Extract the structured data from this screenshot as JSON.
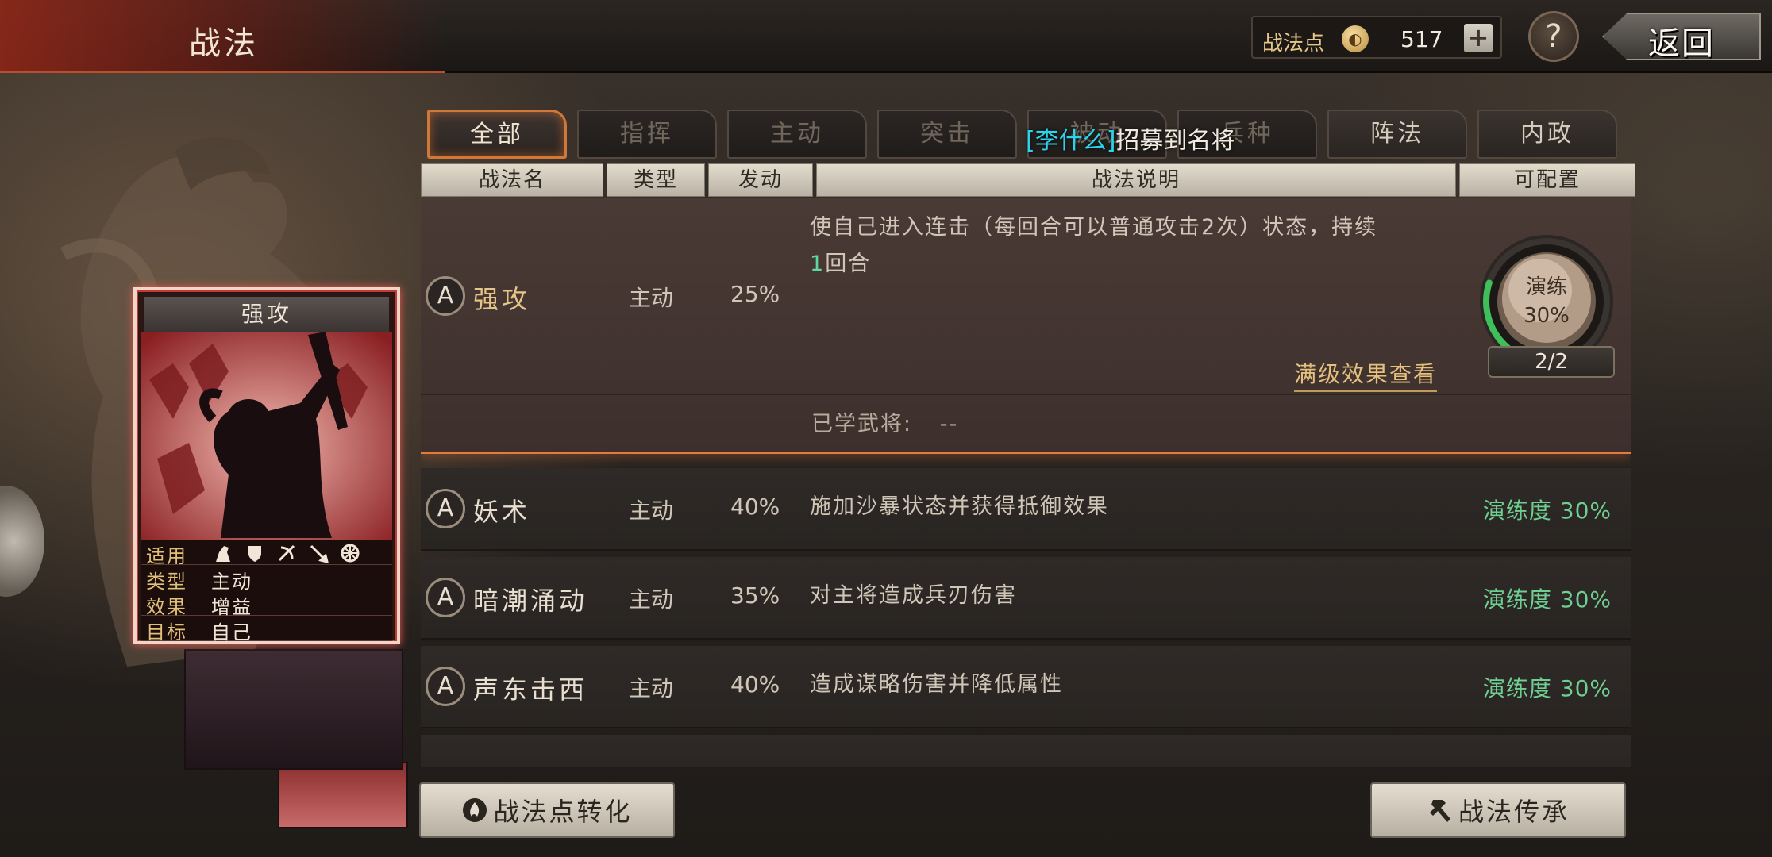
{
  "header": {
    "title": "战法",
    "points_label": "战法点",
    "points_value": "517",
    "plus_label": "+",
    "help_label": "?",
    "back_label": "返回"
  },
  "tabs": [
    {
      "label": "全部",
      "state": "active"
    },
    {
      "label": "指挥",
      "state": "dim"
    },
    {
      "label": "主动",
      "state": "dim"
    },
    {
      "label": "突击",
      "state": "dim"
    },
    {
      "label": "被动",
      "state": "dim"
    },
    {
      "label": "兵种",
      "state": "dim"
    },
    {
      "label": "阵法",
      "state": "normal"
    },
    {
      "label": "内政",
      "state": "normal"
    }
  ],
  "toast": {
    "name": "[李什么]",
    "text": "招募到名将"
  },
  "columns": [
    "战法名",
    "类型",
    "发动",
    "战法说明",
    "可配置"
  ],
  "selected": {
    "badge": "A",
    "name": "强攻",
    "type": "主动",
    "rate": "25%",
    "desc_line1": "使自己进入连击（每回合可以普通攻击2次）状态，持续",
    "desc_num": "1",
    "desc_line2_rest": "回合",
    "full_effect": "满级效果查看",
    "learned_label": "已学武将:",
    "learned_value": "--",
    "train_label": "演练",
    "train_pct": "30%",
    "train_count": "2/2",
    "train_progress": 0.3
  },
  "rows": [
    {
      "badge": "A",
      "name": "妖术",
      "type": "主动",
      "rate": "40%",
      "desc": "施加沙暴状态并获得抵御效果",
      "mastery": "演练度 30%"
    },
    {
      "badge": "A",
      "name": "暗潮涌动",
      "type": "主动",
      "rate": "35%",
      "desc": "对主将造成兵刃伤害",
      "mastery": "演练度 30%"
    },
    {
      "badge": "A",
      "name": "声东击西",
      "type": "主动",
      "rate": "40%",
      "desc": "造成谋略伤害并降低属性",
      "mastery": "演练度 30%"
    }
  ],
  "card": {
    "title": "强攻",
    "rows": [
      {
        "key": "适用",
        "value": ""
      },
      {
        "key": "类型",
        "value": "主动"
      },
      {
        "key": "效果",
        "value": "增益"
      },
      {
        "key": "目标",
        "value": "自己"
      }
    ],
    "unit_icons": [
      "cavalry-icon",
      "shield-icon",
      "bow-icon",
      "spear-icon",
      "wheel-icon"
    ]
  },
  "buttons": {
    "convert": "战法点转化",
    "inherit": "战法传承"
  },
  "colors": {
    "accent_orange": "#e57a3c",
    "mastery_green": "#6fcf93",
    "toast_cyan": "#2bd3ec",
    "gold_text": "#e6c589"
  }
}
